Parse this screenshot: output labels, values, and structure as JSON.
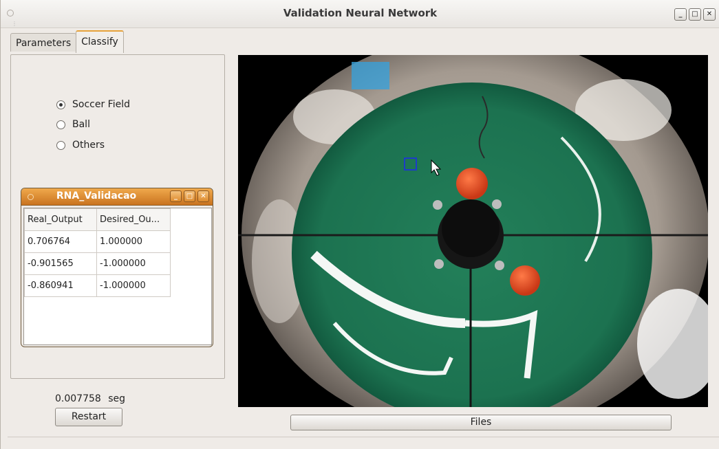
{
  "window": {
    "title": "Validation Neural Network",
    "buttons": {
      "minimize": "_",
      "maximize": "□",
      "close": "✕"
    }
  },
  "tabs": [
    {
      "label": "Parameters",
      "active": false
    },
    {
      "label": "Classify",
      "active": true
    }
  ],
  "classify": {
    "radios": [
      {
        "label": "Soccer Field",
        "checked": true
      },
      {
        "label": "Ball",
        "checked": false
      },
      {
        "label": "Others",
        "checked": false
      }
    ]
  },
  "subwindow": {
    "title": "RNA_Validacao",
    "buttons": {
      "minimize": "_",
      "maximize": "□",
      "close": "✕"
    },
    "columns": [
      "Real_Output",
      "Desired_Ou..."
    ],
    "rows": [
      [
        "0.706764",
        "1.000000"
      ],
      [
        "-0.901565",
        "-1.000000"
      ],
      [
        "-0.860941",
        "-1.000000"
      ]
    ]
  },
  "footer": {
    "time_value": "0.007758",
    "time_unit": "seg",
    "restart_label": "Restart",
    "files_label": "Files"
  },
  "colors": {
    "field_green": "#1f7a55",
    "ball_orange": "#e8502a",
    "title_orange": "#d9852f"
  }
}
